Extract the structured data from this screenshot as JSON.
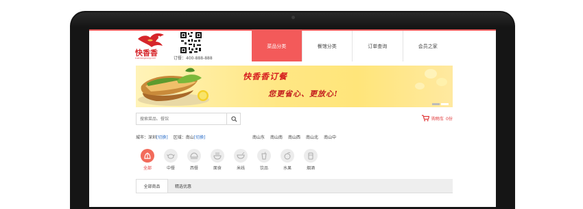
{
  "header": {
    "logo_text": "快香香",
    "logo_subtext": "kuaixiangxiang.com",
    "phone": "订餐：400-888-888"
  },
  "nav": {
    "items": [
      {
        "label": "菜品分类",
        "active": true
      },
      {
        "label": "餐馆分类",
        "active": false
      },
      {
        "label": "订单查询",
        "active": false
      },
      {
        "label": "会员之家",
        "active": false
      }
    ]
  },
  "banner": {
    "title": "快香香订餐",
    "slogan": "您更省心、更放心!"
  },
  "search": {
    "placeholder": "搜索菜品、餐馆"
  },
  "cart": {
    "label": "购物车",
    "count": "0份"
  },
  "location": {
    "city_label": "城市：",
    "city": "深圳",
    "district_label": "区域：",
    "district": "南山",
    "switch_label": "[切换]",
    "areas": [
      "南山东",
      "南山南",
      "南山西",
      "南山北",
      "南山中"
    ]
  },
  "categories": [
    {
      "label": "全部",
      "icon": "all-icon",
      "active": true
    },
    {
      "label": "中餐",
      "icon": "chicken-icon",
      "active": false
    },
    {
      "label": "西餐",
      "icon": "western-food-icon",
      "active": false
    },
    {
      "label": "面食",
      "icon": "noodle-icon",
      "active": false
    },
    {
      "label": "米线",
      "icon": "rice-noodle-bowl-icon",
      "active": false
    },
    {
      "label": "饮品",
      "icon": "drink-icon",
      "active": false
    },
    {
      "label": "水果",
      "icon": "fruit-icon",
      "active": false
    },
    {
      "label": "烟酒",
      "icon": "tobacco-wine-icon",
      "active": false
    }
  ],
  "tabs": [
    {
      "label": "全部商品",
      "active": true
    },
    {
      "label": "精选优惠",
      "active": false
    }
  ],
  "colors": {
    "accent": "#f35a5a",
    "link": "#2c6ec8",
    "bezel": "#151515"
  }
}
